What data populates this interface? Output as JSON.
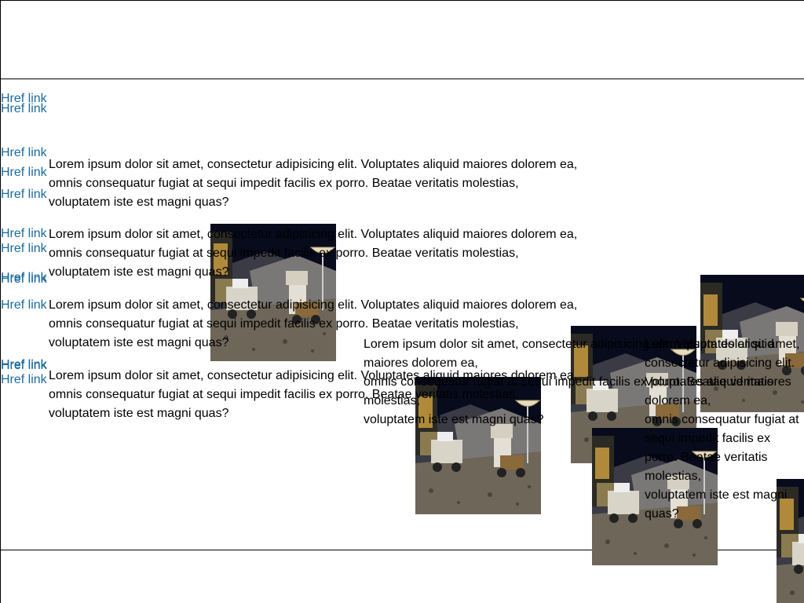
{
  "links": [
    "Href link",
    "Href link",
    "Href link",
    "Href link",
    "Href link",
    "Href link",
    "Href link",
    "Href link",
    "Href link",
    "Href link",
    "Href link",
    "Href link",
    "Href link"
  ],
  "paragraphs": [
    "Lorem ipsum dolor sit amet, consectetur adipisicing elit. Voluptates aliquid maiores dolorem ea,\nomnis consequatur fugiat at sequi impedit facilis ex porro. Beatae veritatis molestias,\nvoluptatem iste est magni quas?",
    "Lorem ipsum dolor sit amet, consectetur adipisicing elit. Voluptates aliquid maiores dolorem ea,\nomnis consequatur fugiat at sequi impedit facilis ex porro. Beatae veritatis molestias,\nvoluptatem iste est magni quas?",
    "Lorem ipsum dolor sit amet, consectetur adipisicing elit. Voluptates aliquid maiores dolorem ea,\nomnis consequatur fugiat at sequi impedit facilis ex porro. Beatae veritatis molestias,\nvoluptatem iste est magni quas?",
    "Lorem ipsum dolor sit amet, consectetur adipisicing elit. Voluptates aliquid maiores dolorem ea,\nomnis consequatur fugiat at sequi impedit facilis ex porro. Beatae veritatis molestias,\nvoluptatem iste est magni quas?",
    "Lorem ipsum dolor sit amet, consectetur adipisicing elit. Voluptates aliquid maiores dolorem ea,\nomnis consequatur fugiat at sequi impedit facilis ex porro. Beatae veritatis molestias,\nvoluptatem iste est magni quas?",
    "Lorem ipsum dolor sit amet, consectetur adipisicing elit. Voluptates aliquid maiores dolorem ea,\nomnis consequatur fugiat at sequi impedit facilis ex porro. Beatae veritatis molestias,\nvoluptatem iste est magni quas?"
  ],
  "colors": {
    "link": "#1a6aa0",
    "text": "#000000",
    "border": "#000000"
  }
}
